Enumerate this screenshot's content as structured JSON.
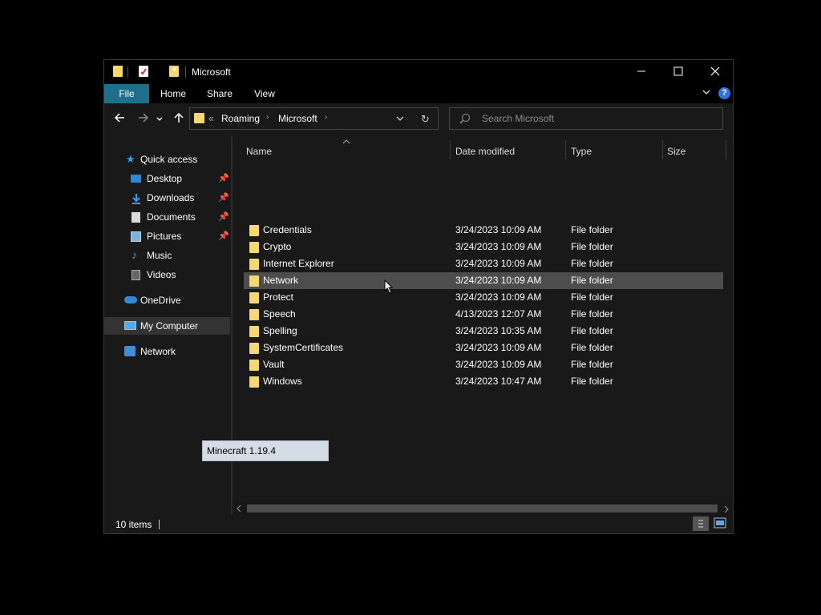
{
  "window": {
    "title": "Microsoft"
  },
  "ribbon": {
    "tabs": [
      "File",
      "Home",
      "Share",
      "View"
    ]
  },
  "address": {
    "crumb_prefix": "«",
    "crumbs": [
      "Roaming",
      "Microsoft"
    ]
  },
  "search": {
    "placeholder": "Search Microsoft"
  },
  "sidebar": {
    "quick_access": "Quick access",
    "quick_items": [
      {
        "label": "Desktop",
        "pinned": true
      },
      {
        "label": "Downloads",
        "pinned": true
      },
      {
        "label": "Documents",
        "pinned": true
      },
      {
        "label": "Pictures",
        "pinned": true
      },
      {
        "label": "Music",
        "pinned": false
      },
      {
        "label": "Videos",
        "pinned": false
      }
    ],
    "onedrive": "OneDrive",
    "my_computer": "My Computer",
    "network": "Network"
  },
  "columns": [
    "Name",
    "Date modified",
    "Type",
    "Size"
  ],
  "rows": [
    {
      "name": "Credentials",
      "date": "3/24/2023 10:09 AM",
      "type": "File folder"
    },
    {
      "name": "Crypto",
      "date": "3/24/2023 10:09 AM",
      "type": "File folder"
    },
    {
      "name": "Internet Explorer",
      "date": "3/24/2023 10:09 AM",
      "type": "File folder"
    },
    {
      "name": "Network",
      "date": "3/24/2023 10:09 AM",
      "type": "File folder"
    },
    {
      "name": "Protect",
      "date": "3/24/2023 10:09 AM",
      "type": "File folder"
    },
    {
      "name": "Speech",
      "date": "4/13/2023 12:07 AM",
      "type": "File folder"
    },
    {
      "name": "Spelling",
      "date": "3/24/2023 10:35 AM",
      "type": "File folder"
    },
    {
      "name": "SystemCertificates",
      "date": "3/24/2023 10:09 AM",
      "type": "File folder"
    },
    {
      "name": "Vault",
      "date": "3/24/2023 10:09 AM",
      "type": "File folder"
    },
    {
      "name": "Windows",
      "date": "3/24/2023 10:47 AM",
      "type": "File folder"
    }
  ],
  "status": {
    "count": "10 items"
  },
  "tooltip": {
    "text": "Minecraft 1.19.4"
  },
  "colors": {
    "accent": "#1f6e8c",
    "folder": "#f7d774",
    "selection": "#4d4d4d",
    "help": "#2f73d6"
  }
}
